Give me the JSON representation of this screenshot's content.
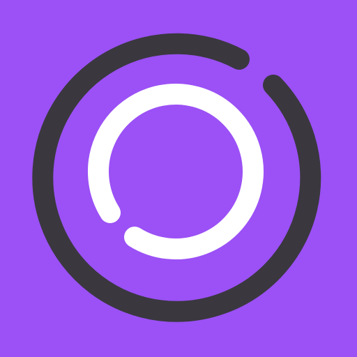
{
  "icon": {
    "name": "double-ring-logo-icon",
    "colors": {
      "background": "#9B51F5",
      "outer_ring": "#3A373F",
      "inner_ring": "#FFFFFF"
    }
  }
}
